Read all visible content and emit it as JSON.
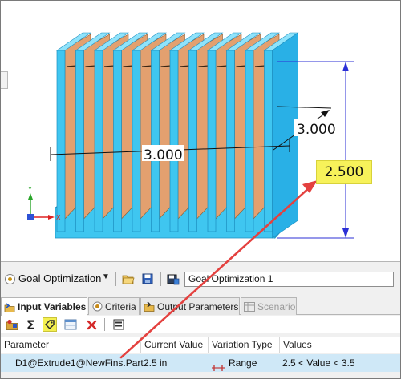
{
  "viewport": {
    "dim_depth": "3.000",
    "dim_width": "3.000",
    "dim_height_highlighted": "2.500",
    "axis_y": "Y",
    "axis_x": "X"
  },
  "study": {
    "type_label": "Goal Optimization",
    "dropdown_glyph": "▼",
    "name_value": "Goal Optimization 1"
  },
  "tabs": [
    {
      "label": "Input Variables",
      "icon": "input-variables-icon",
      "active": true
    },
    {
      "label": "Criteria",
      "icon": "criteria-icon"
    },
    {
      "label": "Output Parameters",
      "icon": "output-parameters-icon"
    },
    {
      "label": "Scenario",
      "icon": "scenario-icon",
      "disabled": true
    }
  ],
  "toolbar": [
    "add-variable-icon",
    "sum-icon",
    "dimension-tag-icon",
    "table-icon",
    "delete-icon",
    "view-icon"
  ],
  "grid": {
    "headers": [
      "Parameter",
      "Current Value",
      "Variation Type",
      "Values"
    ],
    "rows": [
      {
        "parameter": "D1@Extrude1@NewFins.Part",
        "current_value": "2.5 in",
        "variation_type": "Range",
        "values": "2.5 < Value < 3.5"
      }
    ]
  },
  "colors": {
    "fin_blue": "#3fc6f0",
    "fin_copper": "#e3a06f",
    "dimension_blue": "#2b2fd6",
    "highlight_yellow": "#f7f25a",
    "arrow_red": "#e4413f",
    "selected_row": "#cfe8f7"
  }
}
